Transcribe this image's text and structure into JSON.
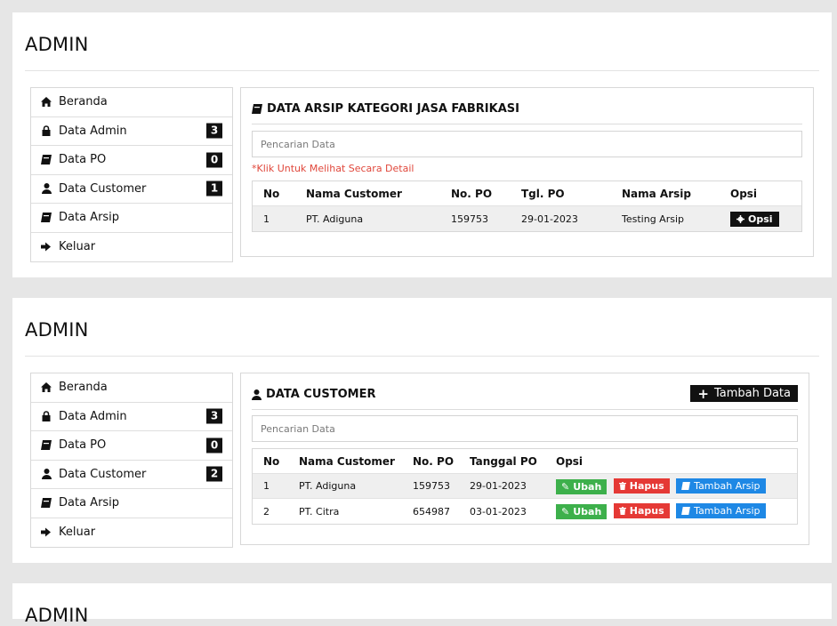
{
  "panels": [
    {
      "admin_title": "ADMIN",
      "sidebar": [
        {
          "label": "Beranda",
          "icon": "home-icon",
          "badge": ""
        },
        {
          "label": "Data Admin",
          "icon": "lock-icon",
          "badge": "3"
        },
        {
          "label": "Data PO",
          "icon": "book-icon",
          "badge": "0"
        },
        {
          "label": "Data Customer",
          "icon": "user-icon",
          "badge": "1"
        },
        {
          "label": "Data Arsip",
          "icon": "book-icon",
          "badge": ""
        },
        {
          "label": "Keluar",
          "icon": "logout-icon",
          "badge": ""
        }
      ],
      "content_title": "DATA ARSIP KATEGORI JASA FABRIKASI",
      "search_placeholder": "Pencarian Data",
      "hint": "*Klik Untuk Melihat Secara Detail",
      "table": {
        "headers": [
          "No",
          "Nama Customer",
          "No. PO",
          "Tgl. PO",
          "Nama Arsip",
          "Opsi"
        ],
        "rows": [
          [
            "1",
            "PT. Adiguna",
            "159753",
            "29-01-2023",
            "Testing Arsip"
          ]
        ],
        "opsi_label": "Opsi"
      }
    },
    {
      "admin_title": "ADMIN",
      "sidebar": [
        {
          "label": "Beranda",
          "icon": "home-icon",
          "badge": ""
        },
        {
          "label": "Data Admin",
          "icon": "lock-icon",
          "badge": "3"
        },
        {
          "label": "Data PO",
          "icon": "book-icon",
          "badge": "0"
        },
        {
          "label": "Data Customer",
          "icon": "user-icon",
          "badge": "2"
        },
        {
          "label": "Data Arsip",
          "icon": "book-icon",
          "badge": ""
        },
        {
          "label": "Keluar",
          "icon": "logout-icon",
          "badge": ""
        }
      ],
      "content_title": "DATA CUSTOMER",
      "add_button": "Tambah Data",
      "search_placeholder": "Pencarian Data",
      "table": {
        "headers": [
          "No",
          "Nama Customer",
          "No. PO",
          "Tanggal PO",
          "Opsi"
        ],
        "rows": [
          [
            "1",
            "PT. Adiguna",
            "159753",
            "29-01-2023"
          ],
          [
            "2",
            "PT. Citra",
            "654987",
            "03-01-2023"
          ]
        ],
        "actions": {
          "edit": "Ubah",
          "delete": "Hapus",
          "add_archive": "Tambah Arsip"
        }
      }
    },
    {
      "admin_title": "ADMIN"
    }
  ],
  "colors": {
    "badge": "#111111",
    "hint": "#e0473b",
    "edit": "#3db04b",
    "delete": "#e53935",
    "add_archive": "#1e88e5"
  }
}
